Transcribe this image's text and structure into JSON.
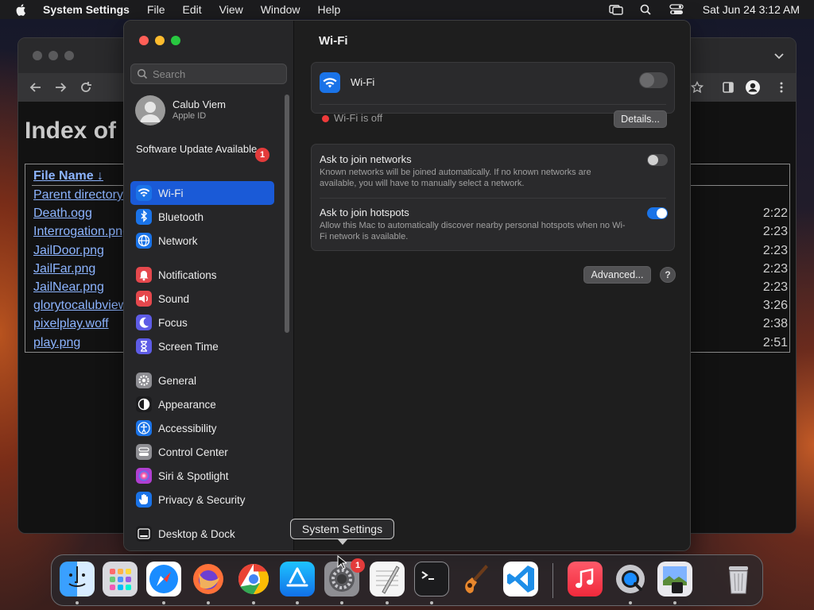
{
  "menubar": {
    "app_name": "System Settings",
    "menus": [
      "File",
      "Edit",
      "View",
      "Window",
      "Help"
    ],
    "clock": "Sat Jun 24  3:12 AM"
  },
  "browser": {
    "page_heading": "Index of",
    "column_header": "File Name  ↓",
    "files": [
      {
        "name": "Parent directory",
        "time": ""
      },
      {
        "name": "Death.ogg",
        "time": "2:22"
      },
      {
        "name": "Interrogation.png",
        "time": "2:23"
      },
      {
        "name": "JailDoor.png",
        "time": "2:23"
      },
      {
        "name": "JailFar.png",
        "time": "2:23"
      },
      {
        "name": "JailNear.png",
        "time": "2:23"
      },
      {
        "name": "glorytocalubview",
        "time": "3:26"
      },
      {
        "name": "pixelplay.woff",
        "time": "2:38"
      },
      {
        "name": "play.png",
        "time": "2:51"
      }
    ]
  },
  "sidebar": {
    "search_placeholder": "Search",
    "profile_name": "Calub Viem",
    "profile_sub": "Apple ID",
    "update_text": "Software Update Available",
    "update_badge": "1",
    "items": [
      {
        "label": "Wi-Fi",
        "icon": "wifi-icon",
        "color": "#1a73e8"
      },
      {
        "label": "Bluetooth",
        "icon": "bluetooth-icon",
        "color": "#1a73e8"
      },
      {
        "label": "Network",
        "icon": "globe-icon",
        "color": "#1a73e8"
      },
      {
        "label": "Notifications",
        "icon": "bell-icon",
        "color": "#e5484d"
      },
      {
        "label": "Sound",
        "icon": "speaker-icon",
        "color": "#e5484d"
      },
      {
        "label": "Focus",
        "icon": "moon-icon",
        "color": "#5e5ce6"
      },
      {
        "label": "Screen Time",
        "icon": "hourglass-icon",
        "color": "#5e5ce6"
      },
      {
        "label": "General",
        "icon": "gear-icon",
        "color": "#8e8e93"
      },
      {
        "label": "Appearance",
        "icon": "appearance-icon",
        "color": "#1c1c1e"
      },
      {
        "label": "Accessibility",
        "icon": "accessibility-icon",
        "color": "#1a73e8"
      },
      {
        "label": "Control Center",
        "icon": "control-center-icon",
        "color": "#8e8e93"
      },
      {
        "label": "Siri & Spotlight",
        "icon": "siri-icon",
        "color": "#b03fd1"
      },
      {
        "label": "Privacy & Security",
        "icon": "hand-icon",
        "color": "#1a73e8"
      },
      {
        "label": "Desktop & Dock",
        "icon": "dock-icon",
        "color": "#1c1c1e"
      }
    ]
  },
  "wifi_pane": {
    "title": "Wi-Fi",
    "wifi_label": "Wi-Fi",
    "wifi_on": false,
    "status": "Wi-Fi is off",
    "details_button": "Details...",
    "ask_networks_title": "Ask to join networks",
    "ask_networks_desc": "Known networks will be joined automatically. If no known networks are available, you will have to manually select a network.",
    "ask_networks_on": false,
    "ask_hotspots_title": "Ask to join hotspots",
    "ask_hotspots_desc": "Allow this Mac to automatically discover nearby personal hotspots when no Wi-Fi network is available.",
    "ask_hotspots_on": true,
    "advanced_button": "Advanced...",
    "help_button": "?"
  },
  "tooltip": "System Settings",
  "dock": {
    "badge": "1",
    "apps": [
      "Finder",
      "Launchpad",
      "Safari",
      "Firefox",
      "Chrome",
      "App Store",
      "System Settings",
      "TextEdit",
      "Terminal",
      "GarageBand",
      "Visual Studio Code",
      "Music",
      "QuickTime Player",
      "Preview",
      "Trash"
    ]
  },
  "colors": {
    "accent": "#1a73e8",
    "selection": "#1a5ad7",
    "status_off": "#ee3a3a",
    "badge": "#e33b3b"
  }
}
